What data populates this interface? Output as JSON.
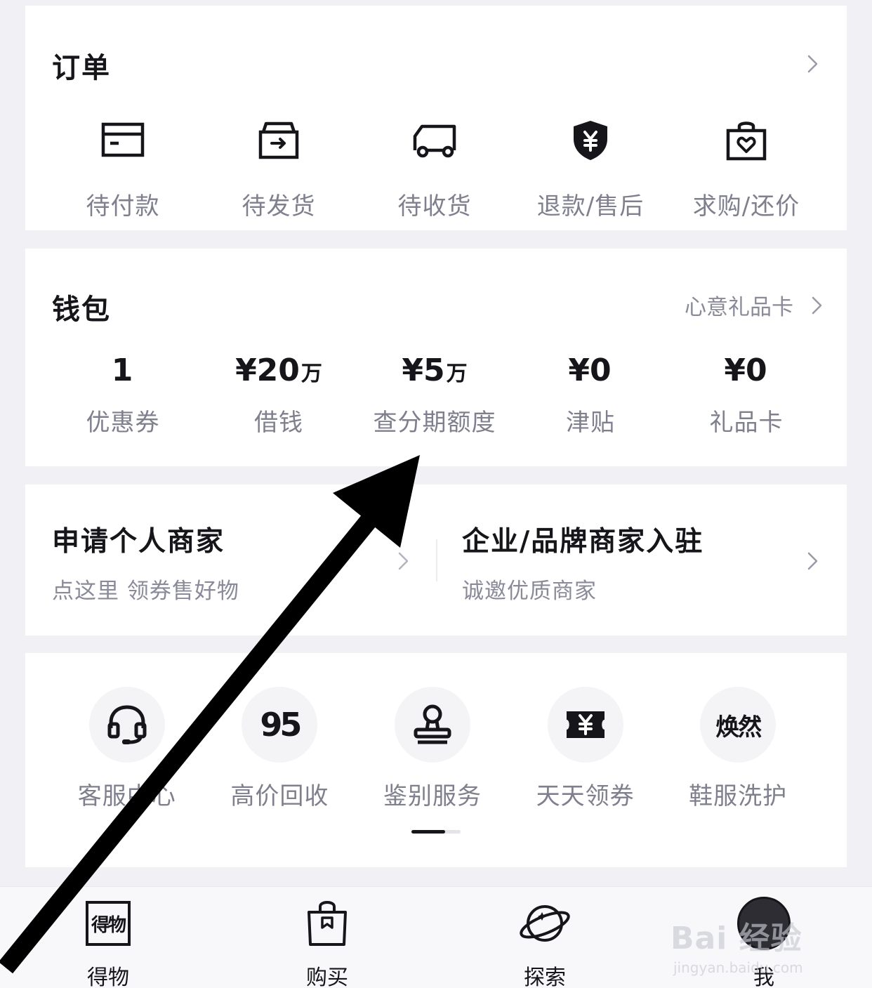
{
  "orders": {
    "title": "订单",
    "items": [
      {
        "label": "待付款",
        "icon": "card-icon"
      },
      {
        "label": "待发货",
        "icon": "box-icon"
      },
      {
        "label": "待收货",
        "icon": "truck-icon"
      },
      {
        "label": "退款/售后",
        "icon": "shield-yen-icon"
      },
      {
        "label": "求购/还价",
        "icon": "heart-bag-icon"
      }
    ]
  },
  "wallet": {
    "title": "钱包",
    "gift_link": "心意礼品卡",
    "items": [
      {
        "value": "1",
        "unit": "",
        "label": "优惠券"
      },
      {
        "value": "¥20",
        "unit": "万",
        "label": "借钱"
      },
      {
        "value": "¥5",
        "unit": "万",
        "label": "查分期额度"
      },
      {
        "value": "¥0",
        "unit": "",
        "label": "津贴"
      },
      {
        "value": "¥0",
        "unit": "",
        "label": "礼品卡"
      }
    ]
  },
  "merchant": {
    "personal": {
      "title": "申请个人商家",
      "subtitle": "点这里 领券售好物"
    },
    "brand": {
      "title": "企业/品牌商家入驻",
      "subtitle": "诚邀优质商家"
    }
  },
  "services": {
    "items": [
      {
        "label": "客服中心",
        "icon": "headset-icon"
      },
      {
        "label": "高价回收",
        "icon": "95-logo-icon",
        "icon_text": "95"
      },
      {
        "label": "鉴别服务",
        "icon": "stamp-icon"
      },
      {
        "label": "天天领券",
        "icon": "coupon-ticket-icon"
      },
      {
        "label": "鞋服洗护",
        "icon": "huanfa-logo-icon",
        "icon_text": "焕然"
      }
    ]
  },
  "tabbar": {
    "items": [
      {
        "label": "得物",
        "icon": "dewu-logo-icon",
        "icon_text": "得物"
      },
      {
        "label": "购买",
        "icon": "shopping-bag-icon"
      },
      {
        "label": "探索",
        "icon": "planet-icon"
      },
      {
        "label": "我",
        "icon": "avatar-icon"
      }
    ]
  },
  "watermark": {
    "line1": "Bai 经验",
    "line2": "jingyan.baidu.com"
  },
  "colors": {
    "background": "#f1f1f5",
    "card": "#ffffff",
    "primary_text": "#16161a",
    "secondary_text": "#7f7f8e",
    "annotation_arrow": "#000000"
  }
}
